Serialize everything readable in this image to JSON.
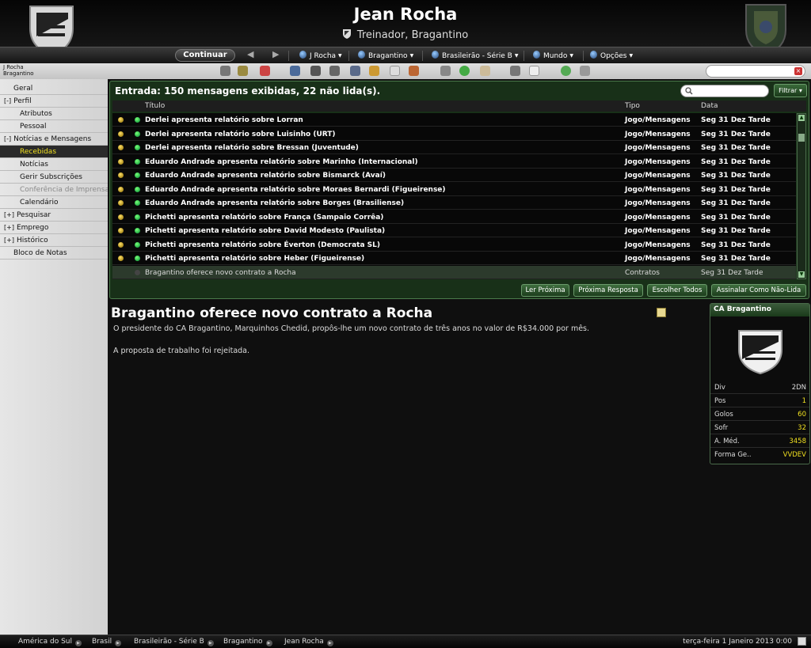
{
  "header": {
    "manager_name": "Jean Rocha",
    "manager_role": "Treinador, Bragantino",
    "left_crest_icon": "bragantino-crest",
    "right_crest_icon": "cbf-crest"
  },
  "navbar": {
    "continue_label": "Continuar",
    "back_icon": "arrow-left",
    "forward_icon": "arrow-right",
    "menus": [
      {
        "label": "J Rocha",
        "icon": "manager-icon"
      },
      {
        "label": "Bragantino",
        "icon": "club-icon"
      },
      {
        "label": "Brasileirão - Série B",
        "icon": "competition-icon"
      },
      {
        "label": "Mundo",
        "icon": "globe-icon"
      },
      {
        "label": "Opções",
        "icon": "options-icon"
      }
    ]
  },
  "user_location": {
    "line1": "J Rocha",
    "line2": "Bragantino"
  },
  "sidebar": {
    "items": [
      {
        "label": "Geral",
        "toggle": ""
      },
      {
        "label": "Perfil",
        "toggle": "[-]"
      },
      {
        "label": "Atributos",
        "toggle": ""
      },
      {
        "label": "Pessoal",
        "toggle": ""
      },
      {
        "label": "Notícias e Mensagens",
        "toggle": "[-]"
      },
      {
        "label": "Recebidas",
        "toggle": ""
      },
      {
        "label": "Notícias",
        "toggle": ""
      },
      {
        "label": "Gerir Subscrições",
        "toggle": ""
      },
      {
        "label": "Conferência de Imprensa",
        "toggle": ""
      },
      {
        "label": "Calendário",
        "toggle": ""
      },
      {
        "label": "Pesquisar",
        "toggle": "[+]"
      },
      {
        "label": "Emprego",
        "toggle": "[+]"
      },
      {
        "label": "Histórico",
        "toggle": "[+]"
      },
      {
        "label": "Bloco de Notas",
        "toggle": ""
      }
    ]
  },
  "inbox": {
    "title": "Entrada: 150 mensagens exibidas, 22 não lida(s).",
    "filter_label": "Filtrar",
    "columns": [
      "Título",
      "Tipo",
      "Data"
    ],
    "rows": [
      {
        "title": "Derlei apresenta relatório sobre Lorran",
        "type": "Jogo/Mensagens",
        "date": "Seg 31 Dez Tarde"
      },
      {
        "title": "Derlei apresenta relatório sobre Luisinho (URT)",
        "type": "Jogo/Mensagens",
        "date": "Seg 31 Dez Tarde"
      },
      {
        "title": "Derlei apresenta relatório sobre Bressan (Juventude)",
        "type": "Jogo/Mensagens",
        "date": "Seg 31 Dez Tarde"
      },
      {
        "title": "Eduardo Andrade apresenta relatório sobre Marinho (Internacional)",
        "type": "Jogo/Mensagens",
        "date": "Seg 31 Dez Tarde"
      },
      {
        "title": "Eduardo Andrade apresenta relatório sobre Bismarck (Avaí)",
        "type": "Jogo/Mensagens",
        "date": "Seg 31 Dez Tarde"
      },
      {
        "title": "Eduardo Andrade apresenta relatório sobre Moraes Bernardi (Figueirense)",
        "type": "Jogo/Mensagens",
        "date": "Seg 31 Dez Tarde"
      },
      {
        "title": "Eduardo Andrade apresenta relatório sobre Borges (Brasiliense)",
        "type": "Jogo/Mensagens",
        "date": "Seg 31 Dez Tarde"
      },
      {
        "title": "Pichetti apresenta relatório sobre França (Sampaio Corrêa)",
        "type": "Jogo/Mensagens",
        "date": "Seg 31 Dez Tarde"
      },
      {
        "title": "Pichetti apresenta relatório sobre David Modesto (Paulista)",
        "type": "Jogo/Mensagens",
        "date": "Seg 31 Dez Tarde"
      },
      {
        "title": "Pichetti apresenta relatório sobre Éverton (Democrata SL)",
        "type": "Jogo/Mensagens",
        "date": "Seg 31 Dez Tarde"
      },
      {
        "title": "Pichetti apresenta relatório sobre Heber (Figueirense)",
        "type": "Jogo/Mensagens",
        "date": "Seg 31 Dez Tarde"
      },
      {
        "title": "Bragantino oferece novo contrato a Rocha",
        "type": "Contratos",
        "date": "Seg 31 Dez Tarde"
      }
    ],
    "actions": [
      "Ler Próxima",
      "Próxima Resposta",
      "Escolher Todos",
      "Assinalar Como Não-Lida"
    ]
  },
  "message": {
    "title": "Bragantino oferece novo contrato a Rocha",
    "paragraph1": "O presidente do CA Bragantino, Marquinhos Chedid, propôs-lhe um novo contrato de três anos no valor de R$34.000 por mês.",
    "paragraph2": "A proposta de trabalho foi rejeitada."
  },
  "club_panel": {
    "title": "CA Bragantino",
    "stats": [
      {
        "key": "Div",
        "value": "2DN"
      },
      {
        "key": "Pos",
        "value": "1"
      },
      {
        "key": "Golos",
        "value": "60"
      },
      {
        "key": "Sofr",
        "value": "32"
      },
      {
        "key": "A. Méd.",
        "value": "3458"
      },
      {
        "key": "Forma Ge..",
        "value": "VVDEV"
      }
    ]
  },
  "status_bar": {
    "breadcrumbs": [
      "América do Sul",
      "Brasil",
      "Brasileirão - Série B",
      "Bragantino",
      "Jean Rocha"
    ],
    "date": "terça-feira 1 Janeiro 2013 0:00"
  },
  "colors": {
    "accent": "#f0e020",
    "panel_green": "#183018",
    "sidebar_bg": "#dcdcdc"
  }
}
